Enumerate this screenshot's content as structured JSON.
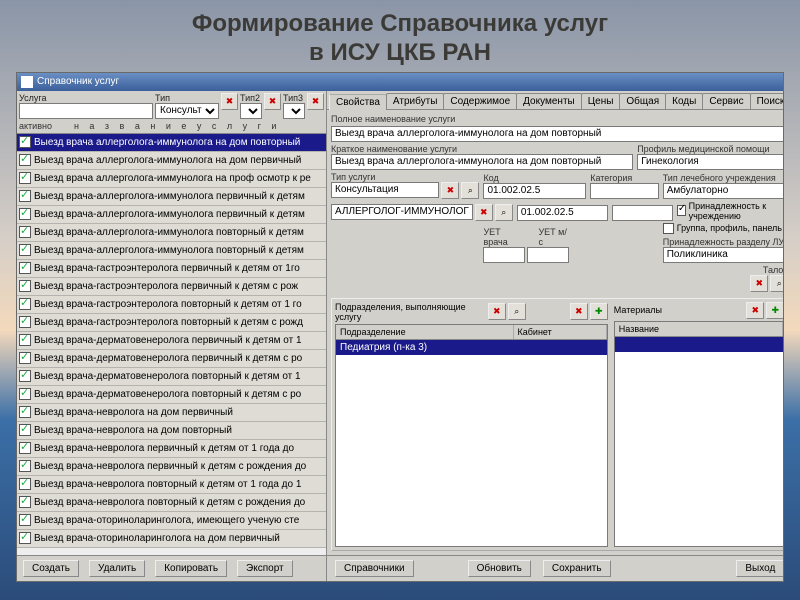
{
  "slide": {
    "title_line1": "Формирование Справочника услуг",
    "title_line2": "в ИСУ ЦКБ РАН"
  },
  "window": {
    "title": "Справочник услуг"
  },
  "left": {
    "filter_labels": {
      "usluga": "Услуга",
      "tip": "Тип",
      "tip2": "Тип2",
      "tip3": "Тип3"
    },
    "tip_value": "Консульт",
    "subheader_activno": "активно",
    "subheader_name": "н а з в а н и е   у с л у г и",
    "rows": [
      "Выезд врача аллерголога-иммунолога на дом повторный",
      "Выезд врача аллерголога-иммунолога на дом первичный",
      "Выезд врача аллерголога-иммунолога на проф осмотр к ре",
      "Выезд врача-аллерголога-иммунолога первичный к  детям",
      "Выезд врача-аллерголога-иммунолога первичный к  детям",
      "Выезд врача-аллерголога-иммунолога повторный к  детям",
      "Выезд врача-аллерголога-иммунолога повторный к  детям",
      "Выезд врача-гастроэнтеролога первичный к  детям от 1го",
      "Выезд врача-гастроэнтеролога первичный к  детям с рож",
      "Выезд врача-гастроэнтеролога повторный к  детям от 1 го",
      "Выезд врача-гастроэнтеролога повторный к  детям с рожд",
      "Выезд врача-дерматовенеролога первичный к  детям от 1",
      "Выезд врача-дерматовенеролога первичный к  детям с ро",
      "Выезд врача-дерматовенеролога повторный к  детям от 1",
      "Выезд врача-дерматовенеролога повторный к  детям с ро",
      "Выезд врача-невролога на дом первичный",
      "Выезд врача-невролога на дом повторный",
      "Выезд врача-невролога первичный к  детям от 1 года до",
      "Выезд врача-невролога первичный к  детям с рождения до",
      "Выезд врача-невролога повторный к  детям от 1 года до 1",
      "Выезд врача-невролога повторный к  детям с рождения до",
      "Выезд врача-оториноларинголога, имеющего ученую сте",
      "Выезд врача-оториноларинголога на дом первичный"
    ],
    "selected_index": 0,
    "buttons": {
      "create": "Создать",
      "delete": "Удалить",
      "copy": "Копировать",
      "export": "Экспорт"
    }
  },
  "right": {
    "tabs": [
      "Свойства",
      "Атрибуты",
      "Содержимое",
      "Документы",
      "Цены",
      "Общая",
      "Коды",
      "Сервис",
      "Поиск"
    ],
    "active_tab": 0,
    "labels": {
      "full_name": "Полное наименование услуги",
      "short_name": "Краткое наименование услуги",
      "profile": "Профиль медицинской помощи",
      "service_type": "Тип услуги",
      "code": "Код",
      "category": "Категория",
      "inst_type": "Тип лечебного учреждения",
      "uet_doctor": "УЕТ врача",
      "uet_nurse": "УЕТ м/с",
      "belongs": "Принадлежность к  учреждению",
      "group": "Группа, профиль, панель",
      "lu_section": "Принадлежность разделу ЛУ",
      "talon": "Талон",
      "departments": "Подразделения, выполняющие услугу",
      "department_col": "Подразделение",
      "cabinet_col": "Кабинет",
      "materials": "Материалы",
      "material_name": "Название"
    },
    "values": {
      "full_name": "Выезд врача аллерголога-иммунолога  на дом повторный",
      "short_name": "Выезд врача аллерголога-иммунолога  на дом повторный",
      "profile": "Гинекология",
      "service_type": "Консультация",
      "specialist": "АЛЛЕРГОЛОГ-ИММУНОЛОГ",
      "code1": "01.002.02.5",
      "code2": "01.002.02.5",
      "inst_type": "Амбулаторно",
      "belongs_checked": true,
      "group_checked": false,
      "lu_section": "Поликлиника",
      "department_row": "Педиатрия (п-ка 3)"
    },
    "bottom_buttons": {
      "refs": "Справочники",
      "refresh": "Обновить",
      "save": "Сохранить",
      "exit": "Выход"
    }
  }
}
